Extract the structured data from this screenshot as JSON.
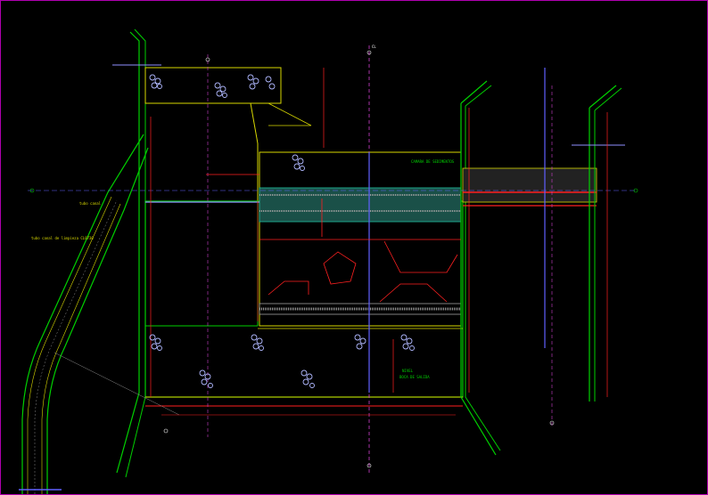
{
  "drawing": {
    "background": "#000000",
    "frame_color": "#b000b0",
    "colors": {
      "wall": "#d8d800",
      "outline_green": "#00d000",
      "dimension": "#ff2020",
      "hatch": "#a0a0a0",
      "rock": "#b0b8ff",
      "axis_blue": "#6060ff",
      "axis_magenta": "#d040d0",
      "pipe_cyan": "#20c0a0",
      "white": "#ffffff"
    },
    "labels": {
      "left_channel_note": "tubo canal de limpieza CL0730",
      "left_channel_note_2": "tubo canal",
      "top_bay_label": "CAMARA DE SEDIMENTOS",
      "bottom_right_label_1": "NIVEL",
      "bottom_right_label_2": "BOCA DE SALIDA",
      "center_axis_mark": "CL"
    },
    "icons": {
      "rock_fill": "riprap-rock-icon",
      "axis_marker": "axis-bubble-icon",
      "section_cut": "section-cut-icon"
    }
  }
}
